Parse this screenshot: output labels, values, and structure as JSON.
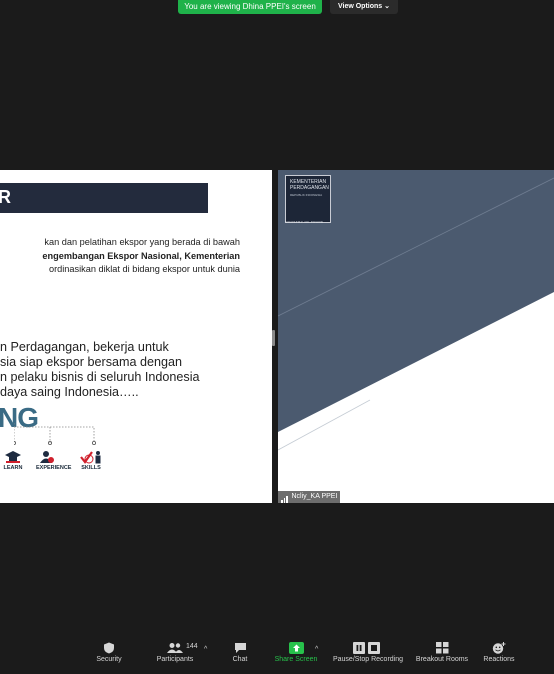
{
  "banner": {
    "viewing_text": "You are viewing Dhina PPEI's screen",
    "view_options_label": "View Options"
  },
  "slide": {
    "header_letter": "R",
    "paragraph1": [
      {
        "text": "kan dan pelatihan ekspor yang berada di bawah",
        "bold": false
      },
      {
        "text": "engembangan Ekspor Nasional, Kementerian",
        "bold": true
      },
      {
        "text": "ordinasikan diklat di bidang ekspor untuk dunia",
        "bold": false
      }
    ],
    "paragraph2": [
      "n Perdagangan, bekerja untuk",
      "sia siap ekspor bersama dengan",
      "n pelaku bisnis di seluruh Indonesia",
      " daya saing Indonesia….."
    ],
    "big_word": "NG",
    "icons": [
      {
        "icon": "graduation-cap-icon",
        "label": "LEARN"
      },
      {
        "icon": "person-badge-icon",
        "label": "EXPERIENCE"
      },
      {
        "icon": "checkmark-person-icon",
        "label": "SKILLS"
      }
    ]
  },
  "video": {
    "logo_title_lines": [
      "KEMENTERIAN",
      "PERDAGANGAN"
    ],
    "logo_subtitle": "REPUBLIK INDONESIA",
    "logo_footer": "MINISTRY OF TRADE",
    "participant_name": "Ncliy_KA PPEI"
  },
  "toolbar": {
    "security": "Security",
    "participants": "Participants",
    "participants_count": "144",
    "chat": "Chat",
    "share_screen": "Share Screen",
    "recording": "Pause/Stop Recording",
    "breakout": "Breakout Rooms",
    "reactions": "Reactions",
    "share_color": "#27c14b"
  }
}
